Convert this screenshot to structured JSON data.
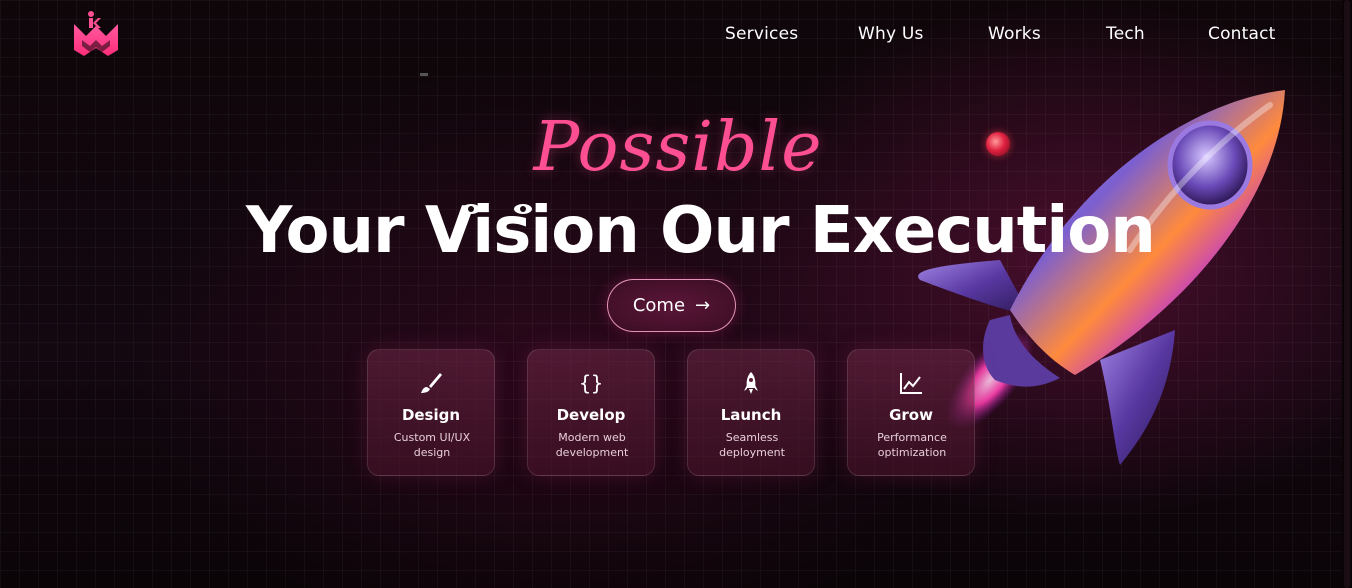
{
  "brand": {
    "logo_icon": "km-crown-logo-icon",
    "accent": "#ff4f93"
  },
  "nav": {
    "items": [
      "Services",
      "Why Us",
      "Works",
      "Tech",
      "Contact"
    ]
  },
  "hero": {
    "script_word": "Possible",
    "headline": "Your Vision Our Execution",
    "cta_label": "Come",
    "cta_icon": "arrow-right-icon"
  },
  "cards": [
    {
      "icon": "paintbrush-icon",
      "title": "Design",
      "desc": "Custom UI/UX design"
    },
    {
      "icon": "curly-braces-icon",
      "title": "Develop",
      "desc": "Modern web development"
    },
    {
      "icon": "rocket-icon",
      "title": "Launch",
      "desc": "Seamless deployment"
    },
    {
      "icon": "line-chart-icon",
      "title": "Grow",
      "desc": "Performance optimization"
    }
  ]
}
